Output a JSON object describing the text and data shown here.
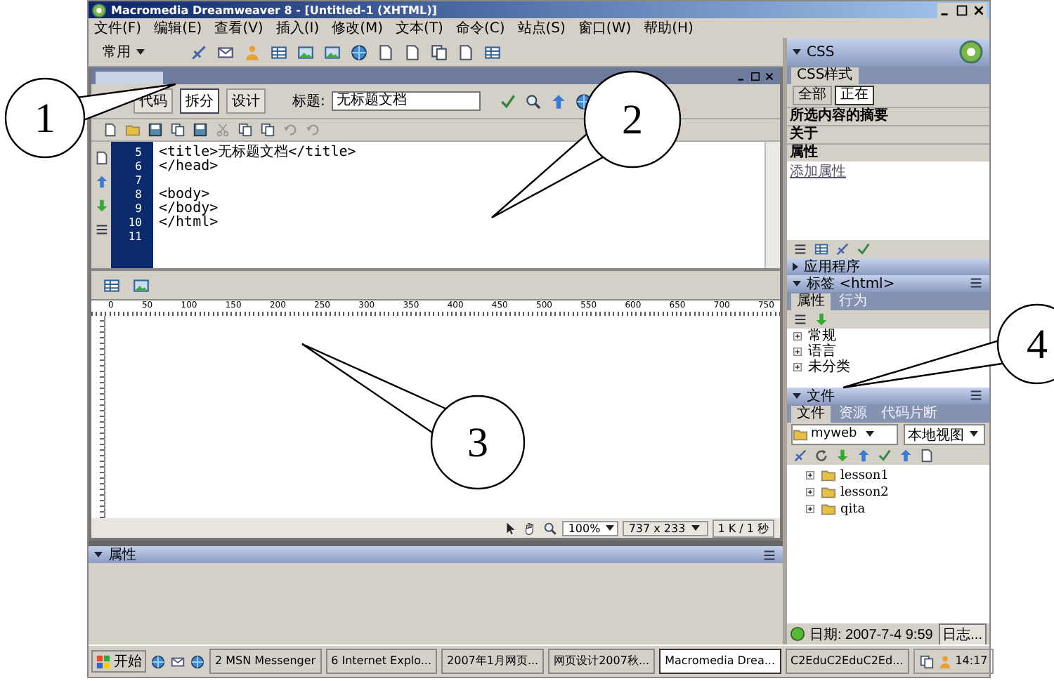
{
  "window": {
    "title": "Macromedia Dreamweaver 8 - [Untitled-1 (XHTML)]"
  },
  "menu": [
    "文件(F)",
    "编辑(E)",
    "查看(V)",
    "插入(I)",
    "修改(M)",
    "文本(T)",
    "命令(C)",
    "站点(S)",
    "窗口(W)",
    "帮助(H)"
  ],
  "insert_bar": {
    "category": "常用"
  },
  "document": {
    "view_tabs": [
      {
        "label": "代码",
        "selected": false
      },
      {
        "label": "拆分",
        "selected": true
      },
      {
        "label": "设计",
        "selected": false
      }
    ],
    "title_label": "标题:",
    "title_value": "无标题文档",
    "code_lines": [
      {
        "number": "5",
        "text": "<title>无标题文档</title>"
      },
      {
        "number": "6",
        "text": "</head>"
      },
      {
        "number": "7"
      },
      {
        "number": "8",
        "text": "<body>"
      },
      {
        "number": "9",
        "text": "</body>"
      },
      {
        "number": "10",
        "text": "</html>"
      },
      {
        "number": "11"
      }
    ],
    "ruler_ticks": [
      "0",
      "50",
      "100",
      "150",
      "200",
      "250",
      "300",
      "350",
      "400",
      "450",
      "500",
      "550",
      "600",
      "650",
      "700",
      "750"
    ],
    "status": {
      "zoom": "100%",
      "size": "737 x 233",
      "weight": "1 K / 1 秒"
    }
  },
  "properties": {
    "title": "属性"
  },
  "css_panel": {
    "title": "CSS",
    "tabs": [
      {
        "label": "CSS样式",
        "selected": true
      }
    ],
    "modes": [
      {
        "label": "全部",
        "selected": false
      },
      {
        "label": "正在",
        "selected": true
      }
    ],
    "sections": [
      "所选内容的摘要",
      "关于",
      "属性"
    ],
    "add_property": "添加属性"
  },
  "app_panel": {
    "title": "应用程序",
    "expanded": false
  },
  "tag_panel": {
    "title": "标签 <html>",
    "expanded": true,
    "tabs": [
      {
        "label": "属性",
        "selected": true
      },
      {
        "label": "行为",
        "selected": false
      }
    ],
    "categories": [
      "常规",
      "语言",
      "未分类"
    ]
  },
  "files_panel": {
    "title": "文件",
    "tabs": [
      {
        "label": "文件",
        "selected": true
      },
      {
        "label": "资源",
        "selected": false
      },
      {
        "label": "代码片断",
        "selected": false
      }
    ],
    "site": "myweb",
    "view": "本地视图",
    "tree": [
      {
        "name": "lesson1"
      },
      {
        "name": "lesson2"
      },
      {
        "name": "qita"
      }
    ],
    "log_date": "日期: 2007-7-4 9:59",
    "log_button": "日志..."
  },
  "taskbar": {
    "start": "开始",
    "tasks": [
      {
        "label": "2 MSN Messenger",
        "selected": false
      },
      {
        "label": "6 Internet Explo...",
        "selected": false
      },
      {
        "label": "2007年1月网页...",
        "selected": false
      },
      {
        "label": "网页设计2007秋...",
        "selected": false
      },
      {
        "label": "Macromedia Drea...",
        "selected": true
      },
      {
        "label": "C2EduC2EduC2Ed...",
        "selected": false
      }
    ],
    "clock": "14:17"
  },
  "callouts": [
    {
      "label": "1"
    },
    {
      "label": "2"
    },
    {
      "label": "3"
    },
    {
      "label": "4"
    }
  ]
}
